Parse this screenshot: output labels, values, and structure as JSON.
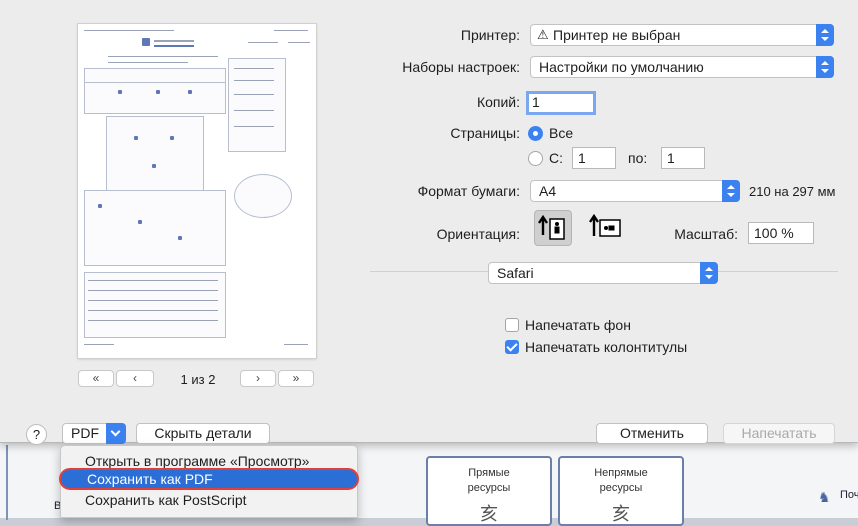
{
  "background": {
    "cards": [
      {
        "line1": "Прямые",
        "line2": "ресурсы"
      },
      {
        "line1": "Непрямые",
        "line2": "ресурсы"
      }
    ],
    "glyph": "亥",
    "right_text": "Поч",
    "left_mark": "Во"
  },
  "preview": {
    "page_indicator": "1 из 2",
    "nav": {
      "first": "«",
      "prev": "‹",
      "next": "›",
      "last": "»"
    }
  },
  "printer": {
    "label": "Принтер:",
    "value": "Принтер не выбран",
    "warning_icon": "warning-icon"
  },
  "presets": {
    "label": "Наборы настроек:",
    "value": "Настройки по умолчанию"
  },
  "copies": {
    "label": "Копий:",
    "value": "1"
  },
  "pages": {
    "label": "Страницы:",
    "all_label": "Все",
    "from_label": "С:",
    "from_value": "1",
    "to_label": "по:",
    "to_value": "1"
  },
  "paper": {
    "label": "Формат бумаги:",
    "value": "A4",
    "size_text": "210 на 297 мм"
  },
  "orientation": {
    "label": "Ориентация:"
  },
  "scale": {
    "label": "Масштаб:",
    "value": "100 %"
  },
  "app_section": {
    "value": "Safari"
  },
  "options": {
    "print_background": "Напечатать фон",
    "print_headers": "Напечатать колонтитулы"
  },
  "footer": {
    "help": "?",
    "pdf": "PDF",
    "hide_details": "Скрыть детали",
    "cancel": "Отменить",
    "print": "Напечатать"
  },
  "pdf_menu": {
    "items": [
      "Открыть в программе «Просмотр»",
      "Сохранить как PDF",
      "Сохранить как PostScript"
    ]
  }
}
